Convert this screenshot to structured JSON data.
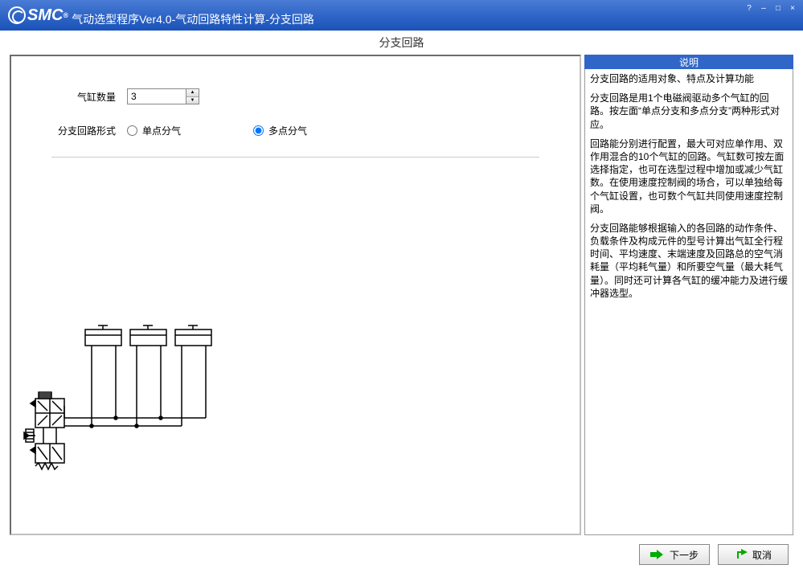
{
  "window": {
    "logo_text": "SMC",
    "title": "气动选型程序Ver4.0-气动回路特性计算-分支回路",
    "help": "?",
    "minimize": "–",
    "maximize": "□",
    "close": "×"
  },
  "page": {
    "heading": "分支回路"
  },
  "form": {
    "cylinder_count_label": "气缸数量",
    "cylinder_count_value": "3",
    "branch_type_label": "分支回路形式",
    "option_single": "单点分气",
    "option_multi": "多点分气",
    "selected": "multi"
  },
  "description": {
    "header": "说明",
    "title_line": "分支回路的适用对象、特点及计算功能",
    "paragraph1": "分支回路是用1个电磁阀驱动多个气缸的回路。按左面“单点分支和多点分支”两种形式对应。",
    "paragraph2": "回路能分别进行配置，最大可对应单作用、双作用混合的10个气缸的回路。气缸数可按左面选择指定，也可在选型过程中增加或减少气缸数。在使用速度控制阀的场合，可以单独给每个气缸设置，也可数个气缸共同使用速度控制阀。",
    "paragraph3": "分支回路能够根据输入的各回路的动作条件、负载条件及构成元件的型号计算出气缸全行程时间、平均速度、末端速度及回路总的空气消耗量（平均耗气量）和所要空气量（最大耗气量）。同时还可计算各气缸的缓冲能力及进行缓冲器选型。"
  },
  "buttons": {
    "next": "下一步",
    "cancel": "取消"
  }
}
